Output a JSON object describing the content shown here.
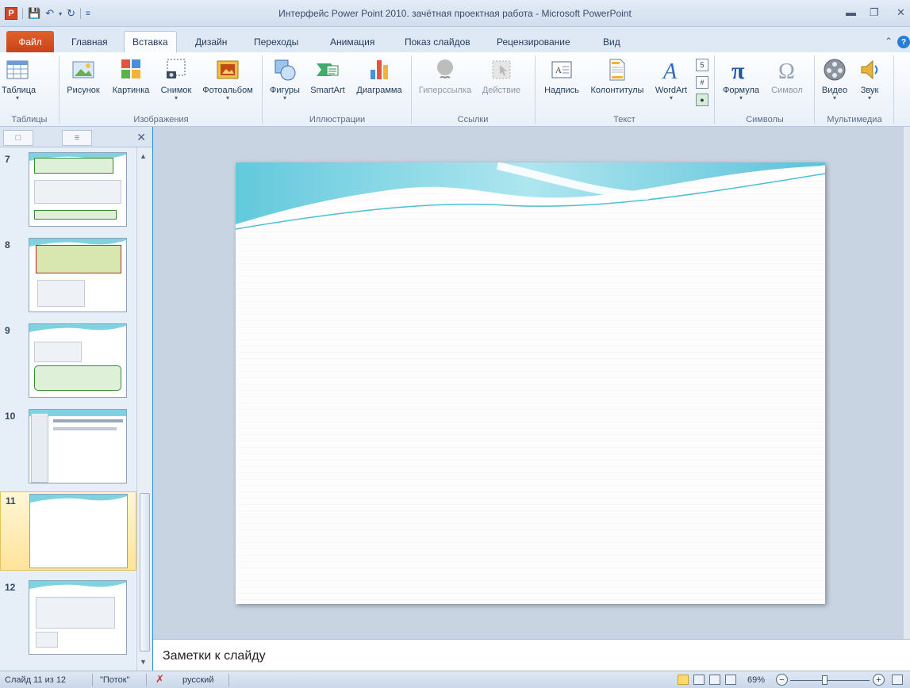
{
  "titlebar": {
    "app_icon": "P",
    "title": "Интерфейс Power Point 2010. зачётная проектная работа - Microsoft PowerPoint",
    "icons": [
      "save-icon",
      "undo-icon",
      "redo-icon",
      "customize-qat-icon",
      "minimize-icon",
      "restore-icon",
      "close-icon"
    ]
  },
  "tabs": [
    "Файл",
    "Главная",
    "Вставка",
    "Дизайн",
    "Переходы",
    "Анимация",
    "Показ слайдов",
    "Рецензирование",
    "Вид"
  ],
  "active_tab": "Вставка",
  "ribbon": {
    "buttons": {
      "table": "Таблица",
      "picture": "Рисунок",
      "clipart": "Картинка",
      "screenshot": "Снимок",
      "photoalbum": "Фотоальбом",
      "shapes": "Фигуры",
      "smartart": "SmartArt",
      "chart": "Диаграмма",
      "hyperlink": "Гиперссылка",
      "action": "Действие",
      "textbox": "Надпись",
      "headerfooter": "Колонтитулы",
      "wordart": "WordArt",
      "equation": "Формула",
      "symbol": "Символ",
      "video": "Видео",
      "audio": "Звук"
    },
    "groups": {
      "tables": "Таблицы",
      "images": "Изображения",
      "illustrations": "Иллюстрации",
      "links": "Ссылки",
      "text": "Текст",
      "symbols": "Символы",
      "media": "Мультимедиа"
    }
  },
  "slides_panel": {
    "thumbs": [
      {
        "num": "7"
      },
      {
        "num": "8"
      },
      {
        "num": "9"
      },
      {
        "num": "10"
      },
      {
        "num": "11"
      },
      {
        "num": "12"
      }
    ],
    "selected": "11"
  },
  "notes": {
    "placeholder": "Заметки к слайду"
  },
  "statusbar": {
    "slide_info": "Слайд 11 из 12",
    "theme": "\"Поток\"",
    "language": "русский",
    "zoom": "69%"
  },
  "colors": {
    "accent": "#2b579a",
    "file_tab": "#c8431a",
    "wave_teal": "#47c1d6"
  }
}
